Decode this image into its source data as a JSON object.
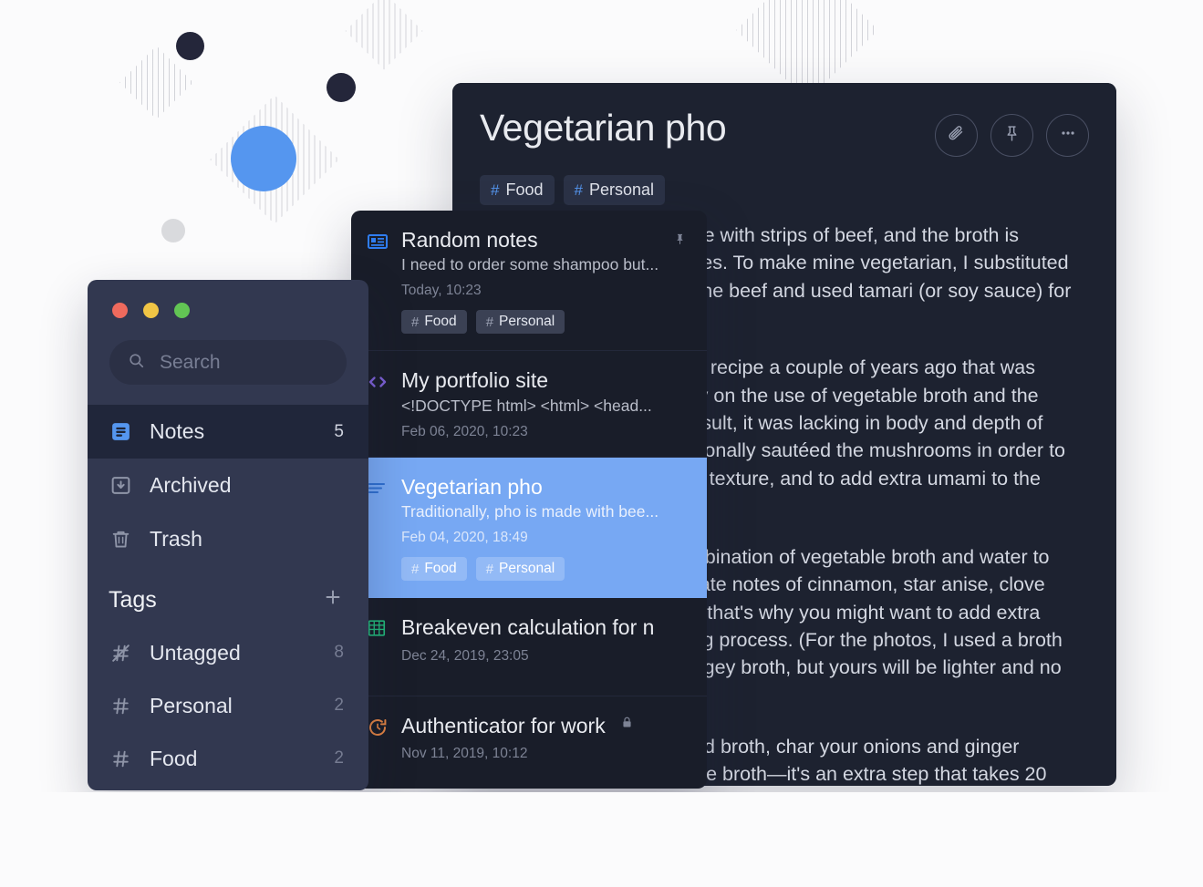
{
  "window_controls": {
    "close": "close",
    "minimize": "minimize",
    "maximize": "maximize"
  },
  "sidebar": {
    "search": {
      "placeholder": "Search",
      "value": "",
      "icon": "search-icon"
    },
    "nav": [
      {
        "label": "Notes",
        "count": "5",
        "icon": "notes-icon",
        "active": true
      },
      {
        "label": "Archived",
        "count": "",
        "icon": "archive-icon",
        "active": false
      },
      {
        "label": "Trash",
        "count": "",
        "icon": "trash-icon",
        "active": false
      }
    ],
    "tags_header": {
      "label": "Tags",
      "add_label": "+",
      "add_icon": "plus-icon"
    },
    "tags": [
      {
        "label": "Untagged",
        "count": "8",
        "icon": "untagged-icon"
      },
      {
        "label": "Personal",
        "count": "2",
        "icon": "hash-icon"
      },
      {
        "label": "Food",
        "count": "2",
        "icon": "hash-icon"
      }
    ]
  },
  "note_list": {
    "items": [
      {
        "title": "Random notes",
        "snippet": "I need to order some shampoo but...",
        "date": "Today, 10:23",
        "tags": [
          "Food",
          "Personal"
        ],
        "icon": "note-lines-icon",
        "pinned": true,
        "locked": false,
        "selected": false
      },
      {
        "title": "My portfolio site",
        "snippet": "<!DOCTYPE html> <html> <head...",
        "date": "Feb 06, 2020, 10:23",
        "tags": [],
        "icon": "code-icon",
        "pinned": false,
        "locked": false,
        "selected": false
      },
      {
        "title": "Vegetarian pho",
        "snippet": "Traditionally, pho is made with bee...",
        "date": "Feb 04, 2020, 18:49",
        "tags": [
          "Food",
          "Personal"
        ],
        "icon": "text-lines-icon",
        "pinned": false,
        "locked": false,
        "selected": true
      },
      {
        "title": "Breakeven calculation for n",
        "snippet": "",
        "date": "Dec 24, 2019, 23:05",
        "tags": [],
        "icon": "spreadsheet-icon",
        "pinned": false,
        "locked": false,
        "selected": false
      },
      {
        "title": "Authenticator for work",
        "snippet": "",
        "date": "Nov 11, 2019, 10:12",
        "tags": [],
        "icon": "authenticator-icon",
        "pinned": false,
        "locked": true,
        "selected": false
      }
    ]
  },
  "note_detail": {
    "title": "Vegetarian pho",
    "tags": [
      "Food",
      "Personal"
    ],
    "actions": [
      {
        "name": "attach",
        "icon": "paperclip-icon"
      },
      {
        "name": "pin",
        "icon": "pin-icon"
      },
      {
        "name": "more",
        "icon": "more-icon"
      }
    ],
    "body": [
      "Traditionally, pho is made with strips of beef, and the broth is simmered with beef bones. To make mine vegetarian, I substituted mushrooms in place of the beef and used tamari (or soy sauce) for seasoning.",
      "I made a vegetarian pho recipe a couple of years ago that was quite simple, relying only on the use of vegetable broth and the spices for flavor. As a result, it was lacking in body and depth of flavor. This time, I intentionally sautéed the mushrooms in order to develop more flavor and texture, and to add extra umami to the broth. Success!",
      "This version uses a combination of vegetable broth and water to form the base with delicate notes of cinnamon, star anise, clove and coriander seed. So, that's why you might want to add extra tamari during the cooking process. (For the photos, I used a broth brand giving a very orangey broth, but yours will be lighter and no less in flavor.)",
      "Tip: For a deeply flavored broth, char your onions and ginger before adding them to the broth—it's an extra step that takes 20 minutes, but makes the pho taste a little more traditional (see"
    ]
  },
  "colors": {
    "accent_blue": "#5596ef",
    "selection_blue": "#77a8f3",
    "panel_dark": "#1d2230",
    "list_dark": "#191d29",
    "sidebar": "#323850"
  }
}
